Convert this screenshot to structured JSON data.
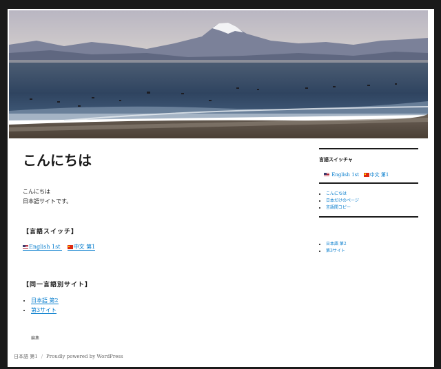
{
  "main": {
    "title": "こんにちは",
    "paragraph_lines": [
      "こんにちは",
      "日本語サイトです。"
    ],
    "switcher_heading": "【言語スイッチ】",
    "switcher_links": [
      {
        "label": "English 1st",
        "flag": "us-flag-icon"
      },
      {
        "label": "中文 第1",
        "flag": "china-flag-icon"
      }
    ],
    "other_sites_heading": "【同一言語別サイト】",
    "other_sites": [
      "日本語 第2",
      "第3サイト"
    ],
    "edit_label": "編集"
  },
  "sidebar": {
    "switcher_title": "言語スイッチャ",
    "switcher_links": [
      {
        "label": "English 1st",
        "flag": "us-flag-icon"
      },
      {
        "label": "中文 第1",
        "flag": "china-flag-icon"
      }
    ],
    "pages": [
      "こんにちは",
      "日本だけのページ",
      "言語間コピー"
    ],
    "sites": [
      "日本語 第2",
      "第3サイト"
    ]
  },
  "footer": {
    "site_name": "日本語 第1",
    "separator": "/",
    "powered_by": "Proudly powered by WordPress"
  },
  "colors": {
    "link": "#007acc",
    "text": "#1a1a1a",
    "frame": "#1a1a1a"
  }
}
